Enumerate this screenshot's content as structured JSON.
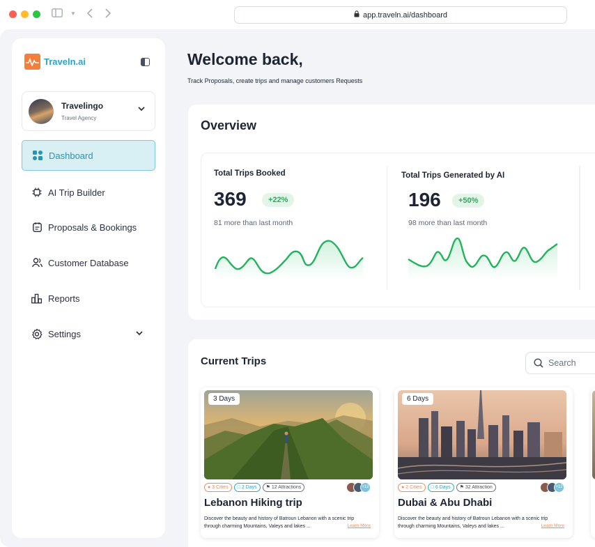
{
  "browser": {
    "url": "app.traveln.ai/dashboard"
  },
  "brand": {
    "name": "Traveln.ai",
    "accent": "#2aa5c7",
    "logo_color": "#f47f3a"
  },
  "agency": {
    "name": "Travelingo",
    "type": "Travel Agency"
  },
  "nav": {
    "items": [
      {
        "label": "Dashboard",
        "icon": "grid-icon",
        "active": true
      },
      {
        "label": "AI Trip Builder",
        "icon": "chip-icon",
        "active": false
      },
      {
        "label": "Proposals & Bookings",
        "icon": "document-icon",
        "active": false
      },
      {
        "label": "Customer Database",
        "icon": "users-icon",
        "active": false
      },
      {
        "label": "Reports",
        "icon": "bar-chart-icon",
        "active": false
      },
      {
        "label": "Settings",
        "icon": "gear-icon",
        "active": false
      }
    ]
  },
  "header": {
    "title": "Welcome back,",
    "subtitle": "Track Proposals, create trips and manage customers Requests"
  },
  "overview": {
    "title": "Overview",
    "stats": [
      {
        "label": "Total Trips Booked",
        "value": "369",
        "change": "+22%",
        "note": "81 more than last month"
      },
      {
        "label": "Total Trips Generated by AI",
        "value": "196",
        "change": "+50%",
        "note": "98 more than last month"
      }
    ],
    "positive_color": "#2ea85b"
  },
  "trips": {
    "title": "Current Trips",
    "search_placeholder": "Search",
    "cards": [
      {
        "duration": "3 Days",
        "cities": "3 Cities",
        "days": "2 Days",
        "attractions": "12 Attractions",
        "extra_travelers": "+12",
        "title": "Lebanon Hiking trip",
        "description": "Discover the beauty and history of Batroun Lebanon with a scenic trip through charming Mountains, Valeys and lakes ...",
        "learn_more": "Learn More"
      },
      {
        "duration": "6 Days",
        "cities": "2 Cities",
        "days": "6 Days",
        "attractions": "32 Attraction",
        "extra_travelers": "+12",
        "title": "Dubai & Abu Dhabi",
        "description": "Discover the beauty and history of Batroun Lebanon with a scenic trip through charming Mountains, Valeys and lakes ...",
        "learn_more": "Learn More"
      }
    ]
  }
}
